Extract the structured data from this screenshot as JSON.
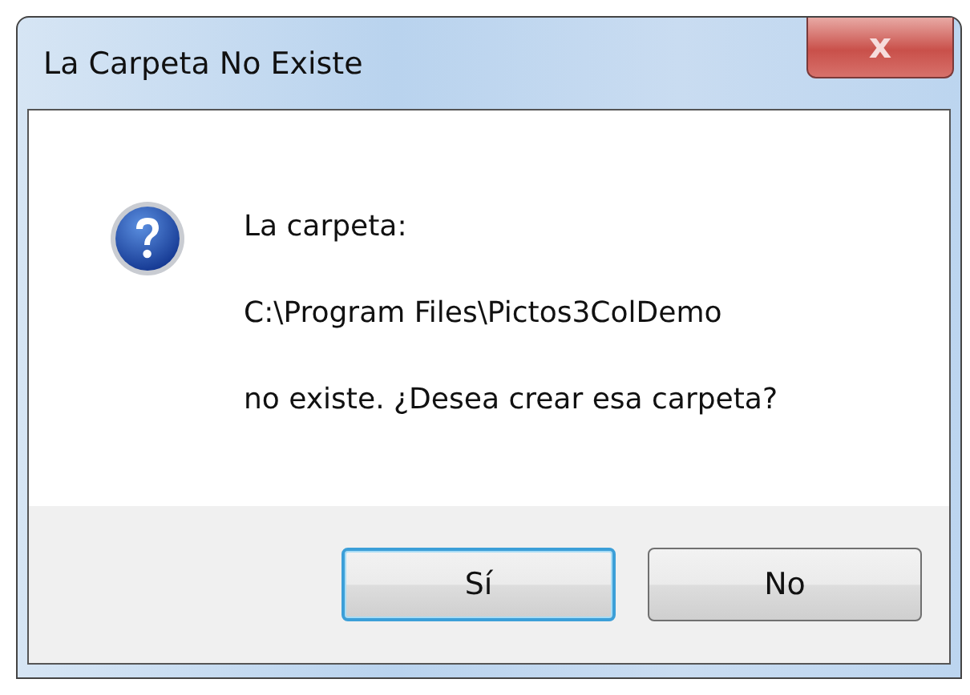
{
  "window": {
    "title": "La Carpeta No Existe",
    "close_button": "x"
  },
  "message": {
    "lines": [
      "La carpeta:",
      "C:\\Program Files\\Pictos3ColDemo",
      "no existe. ¿Desea crear esa carpeta?"
    ]
  },
  "buttons": [
    {
      "label": "Sí",
      "focused": true
    },
    {
      "label": "No",
      "focused": false
    }
  ]
}
